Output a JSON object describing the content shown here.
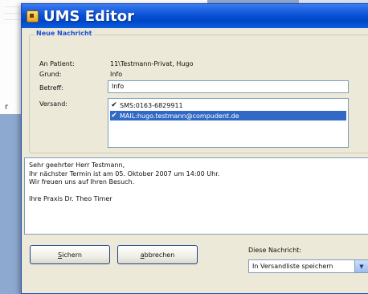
{
  "background": {
    "fragment_text": "r"
  },
  "window": {
    "title": "UMS Editor"
  },
  "group": {
    "label": "Neue Nachricht"
  },
  "fields": {
    "patient_label": "An Patient:",
    "patient_value": "11\\Testmann-Privat, Hugo",
    "reason_label": "Grund:",
    "reason_value": "Info",
    "subject_label": "Betreff:",
    "subject_value": "Info",
    "dispatch_label": "Versand:"
  },
  "dispatch_items": [
    {
      "label": "SMS:0163-6829911",
      "checked": true,
      "selected": false
    },
    {
      "label": "MAIL:hugo.testmann@compudent.de",
      "checked": true,
      "selected": true
    }
  ],
  "message_lines": [
    "Sehr geehrter Herr Testmann,",
    "Ihr nächster Termin ist am 05. Oktober 2007 um 14:00 Uhr.",
    "Wir freuen uns auf Ihren Besuch.",
    "",
    "Ihre Praxis Dr. Theo Timer"
  ],
  "buttons": {
    "save": "Sichern",
    "cancel": "abbrechen"
  },
  "message_option": {
    "label": "Diese Nachricht:",
    "selected": "In Versandliste speichern"
  },
  "colors": {
    "titlebar": "#0a52d6",
    "accent": "#2050d0",
    "selection": "#316ac5"
  }
}
